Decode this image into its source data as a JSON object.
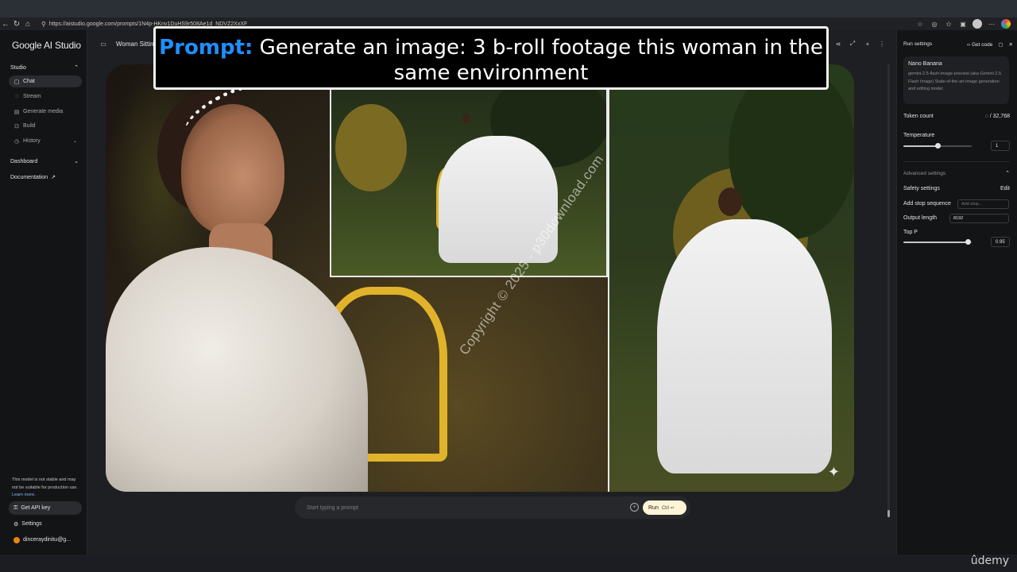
{
  "browser": {
    "url": "https://aistudio.google.com/prompts/1N4p-HKnv1DuHS9r508Ae1d_NDVZ2XxXF"
  },
  "sidebar": {
    "logo": "Google AI Studio",
    "studio_label": "Studio",
    "items": [
      {
        "label": "Chat",
        "icon": "chat-icon",
        "active": true
      },
      {
        "label": "Stream",
        "icon": "stream-icon",
        "active": false
      },
      {
        "label": "Generate media",
        "icon": "media-icon",
        "active": false
      },
      {
        "label": "Build",
        "icon": "build-icon",
        "active": false
      },
      {
        "label": "History",
        "icon": "history-icon",
        "active": false
      }
    ],
    "dashboard_label": "Dashboard",
    "documentation_label": "Documentation",
    "notice_text": "This model is not stable and may not be suitable for production use.",
    "notice_link": "Learn more.",
    "api_key_label": "Get API key",
    "settings_label": "Settings",
    "user_email": "dinceraydinitu@g..."
  },
  "header": {
    "prompt_title": "Woman Sittin"
  },
  "banner": {
    "label": "Prompt:",
    "text": "Generate an image: 3 b-roll footage this woman in the same environment"
  },
  "collage": {
    "watermark": "Copyright © 2025 - p30download.com"
  },
  "prompt_input": {
    "placeholder": "Start typing a prompt",
    "run_label": "Run",
    "run_shortcut": "Ctrl ↵"
  },
  "run_settings": {
    "title": "Run settings",
    "get_code_label": "Get code",
    "model_name": "Nano Banana",
    "model_desc": "gemini-2.5-flash-image-preview (aka Gemini 2.5 Flash Image) State-of-the-art image generation and editing model.",
    "token_count_label": "Token count",
    "token_count_value": "/ 32,768",
    "temperature_label": "Temperature",
    "temperature_value": "1",
    "temperature_fraction": 0.5,
    "advanced_label": "Advanced settings",
    "safety_label": "Safety settings",
    "safety_edit": "Edit",
    "stop_seq_label": "Add stop sequence",
    "stop_seq_placeholder": "Add stop...",
    "output_length_label": "Output length",
    "output_length_value": "8192",
    "top_p_label": "Top P",
    "top_p_value": "0.95",
    "top_p_fraction": 0.95
  },
  "footer": {
    "brand": "ûdemy"
  },
  "colors": {
    "accent_blue": "#1e8fff",
    "run_button": "#fff5d6",
    "link": "#8ab4f8"
  }
}
